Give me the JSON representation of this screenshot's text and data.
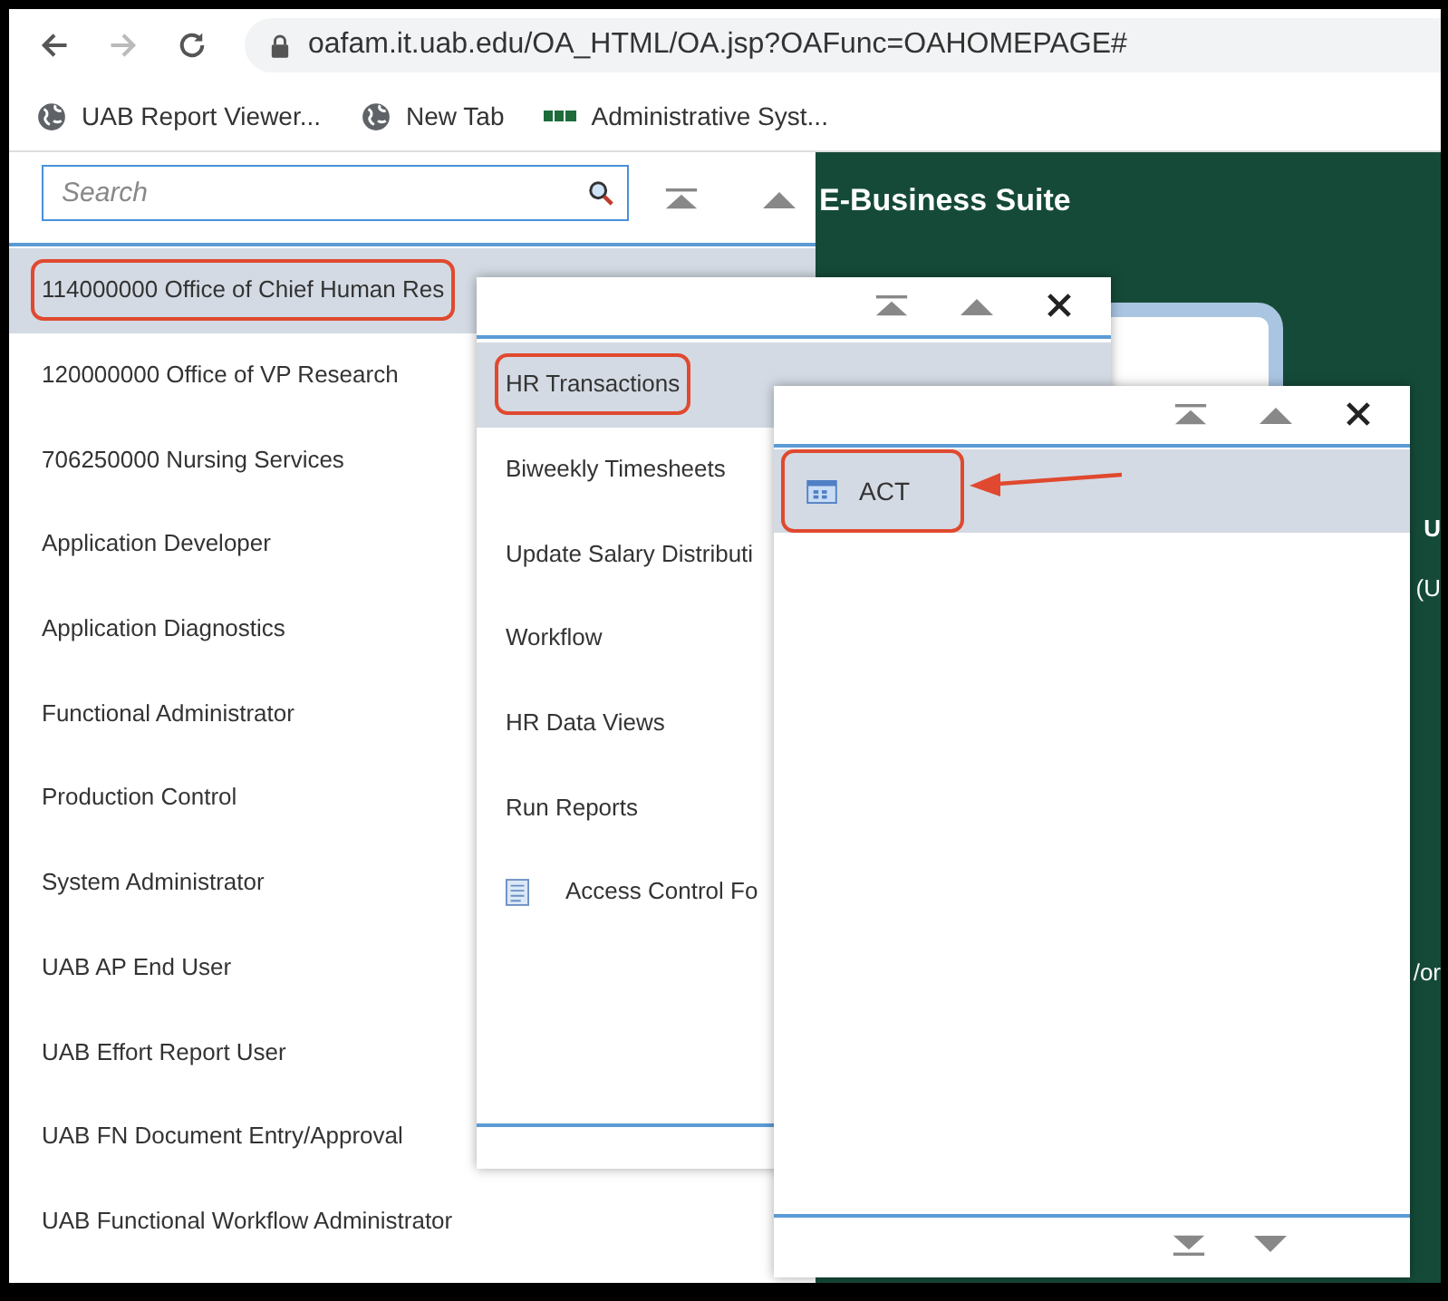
{
  "browser": {
    "url": "oafam.it.uab.edu/OA_HTML/OA.jsp?OAFunc=OAHOMEPAGE#",
    "bookmarks": [
      {
        "label": "UAB Report Viewer...",
        "kind": "globe"
      },
      {
        "label": "New Tab",
        "kind": "globe"
      },
      {
        "label": "Administrative Syst...",
        "kind": "logo"
      }
    ]
  },
  "navigator": {
    "search": {
      "placeholder": "Search"
    },
    "responsibilities": [
      {
        "label": "114000000 Office of Chief Human Res",
        "selected": true,
        "annotated": true
      },
      {
        "label": "120000000 Office of VP Research",
        "selected": false,
        "annotated": false
      },
      {
        "label": "706250000 Nursing Services",
        "selected": false,
        "annotated": false
      },
      {
        "label": "Application Developer",
        "selected": false,
        "annotated": false
      },
      {
        "label": "Application Diagnostics",
        "selected": false,
        "annotated": false
      },
      {
        "label": "Functional Administrator",
        "selected": false,
        "annotated": false
      },
      {
        "label": "Production Control",
        "selected": false,
        "annotated": false
      },
      {
        "label": "System Administrator",
        "selected": false,
        "annotated": false
      },
      {
        "label": "UAB AP End User",
        "selected": false,
        "annotated": false
      },
      {
        "label": "UAB Effort Report User",
        "selected": false,
        "annotated": false
      },
      {
        "label": "UAB FN Document Entry/Approval",
        "selected": false,
        "annotated": false
      },
      {
        "label": "UAB Functional Workflow Administrator",
        "selected": false,
        "annotated": false
      }
    ]
  },
  "menu": [
    {
      "label": "HR Transactions",
      "kind": "folder",
      "selected": true,
      "annotated": true
    },
    {
      "label": "Biweekly Timesheets",
      "kind": "folder",
      "selected": false,
      "annotated": false
    },
    {
      "label": "Update Salary Distributi",
      "kind": "folder",
      "selected": false,
      "annotated": false
    },
    {
      "label": "Workflow",
      "kind": "folder",
      "selected": false,
      "annotated": false
    },
    {
      "label": "HR Data Views",
      "kind": "folder",
      "selected": false,
      "annotated": false
    },
    {
      "label": "Run Reports",
      "kind": "folder",
      "selected": false,
      "annotated": false
    },
    {
      "label": "Access Control Fo",
      "kind": "document",
      "selected": false,
      "annotated": false
    }
  ],
  "submenu": [
    {
      "label": "ACT",
      "kind": "form",
      "selected": true,
      "annotated": true,
      "arrow": true
    }
  ],
  "home": {
    "title": "E-Business Suite",
    "cut_texts": [
      "U",
      "(U",
      "/or"
    ]
  }
}
